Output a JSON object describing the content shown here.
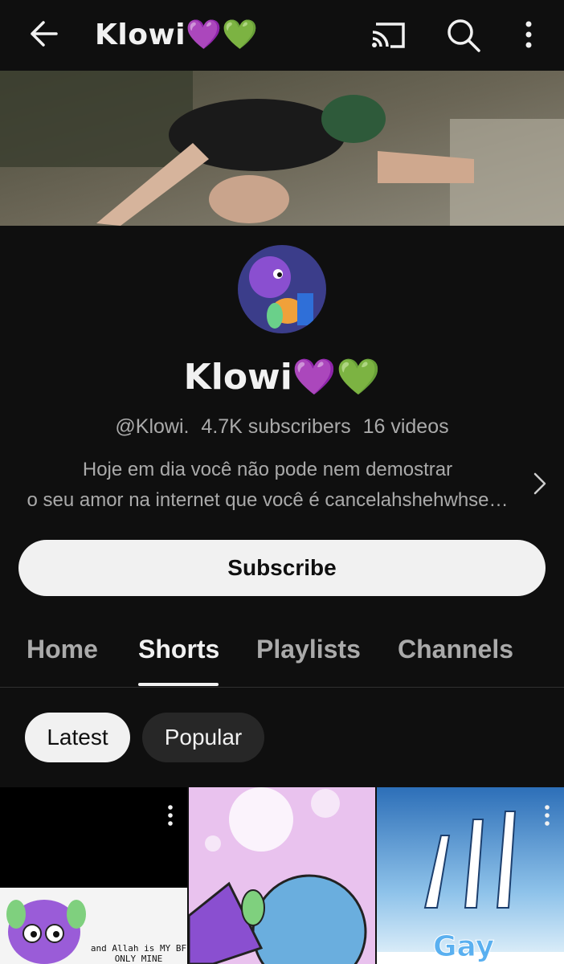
{
  "appbar": {
    "title": "Klowi💜💚",
    "icons": [
      "back-arrow-icon",
      "cast-icon",
      "search-icon",
      "more-vert-icon"
    ]
  },
  "channel": {
    "name": "Klowi💜💚",
    "handle": "@Klowi.",
    "subscribers": "4.7K subscribers",
    "videos": "16 videos",
    "description_line1": "Hoje em dia você não pode nem demostrar",
    "description_line2": "o seu amor na internet que você é cancelahshehwhse…"
  },
  "subscribe_label": "Subscribe",
  "tabs": [
    {
      "label": "Home",
      "active": false
    },
    {
      "label": "Shorts",
      "active": true
    },
    {
      "label": "Playlists",
      "active": false
    },
    {
      "label": "Channels",
      "active": false
    }
  ],
  "chips": [
    {
      "label": "Latest",
      "selected": true
    },
    {
      "label": "Popular",
      "selected": false
    }
  ],
  "shorts": [
    {
      "caption_line1": "and Allah is MY BF",
      "caption_line2": "ONLY MINE"
    },
    {
      "caption_line1": ""
    },
    {
      "overlay_text": "Gay"
    }
  ],
  "colors": {
    "background": "#0f0f0f",
    "text_primary": "#f1f1f1",
    "text_secondary": "#aaaaaa",
    "chip_bg": "#272727"
  }
}
